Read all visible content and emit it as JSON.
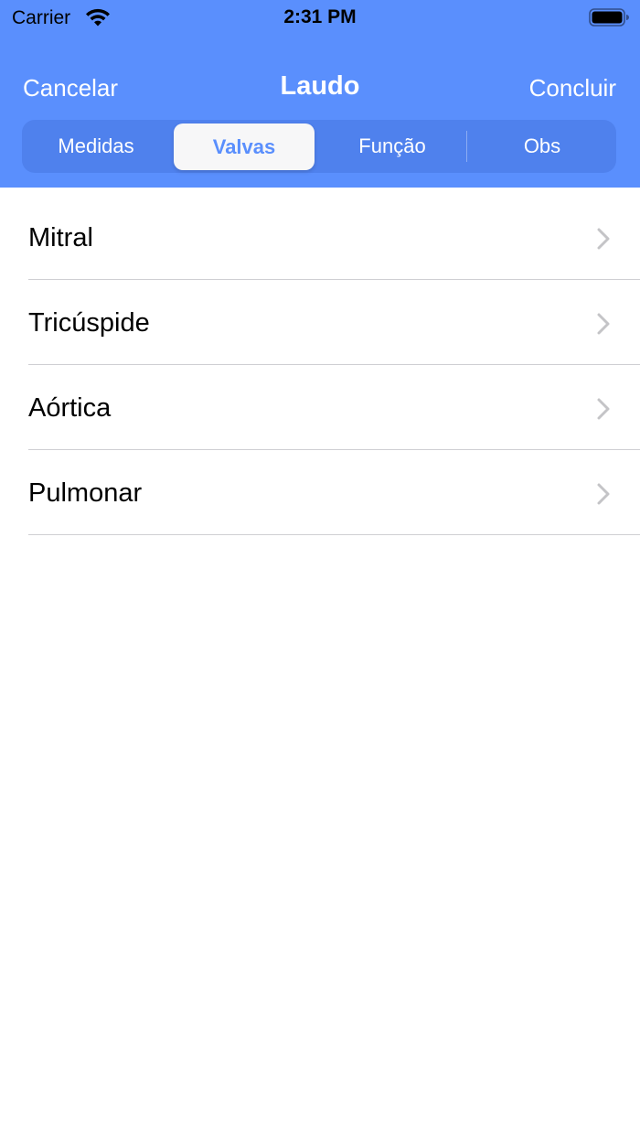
{
  "status_bar": {
    "carrier": "Carrier",
    "time": "2:31 PM",
    "icons": [
      "wifi-icon",
      "battery-icon"
    ]
  },
  "nav": {
    "left_label": "Cancelar",
    "title": "Laudo",
    "right_label": "Concluir"
  },
  "segments": {
    "selected_index": 1,
    "items": [
      {
        "label": "Medidas"
      },
      {
        "label": "Valvas"
      },
      {
        "label": "Função"
      },
      {
        "label": "Obs"
      }
    ]
  },
  "list": {
    "items": [
      {
        "label": "Mitral"
      },
      {
        "label": "Tricúspide"
      },
      {
        "label": "Aórtica"
      },
      {
        "label": "Pulmonar"
      }
    ]
  },
  "colors": {
    "accent": "#5a8ffd",
    "separator": "#cfcfd3",
    "chevron": "#c4c4c7"
  }
}
